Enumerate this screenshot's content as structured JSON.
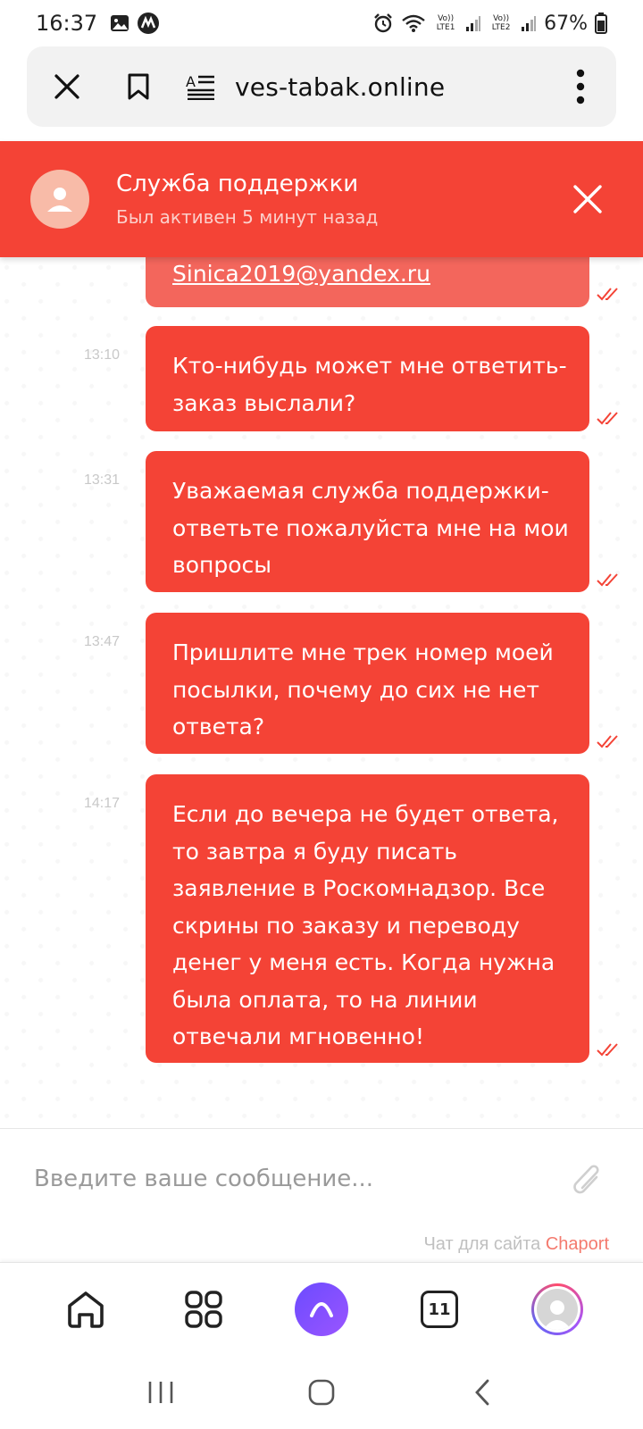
{
  "status_bar": {
    "time": "16:37",
    "battery": "67%",
    "sim1_label": "Vo)) LTE1",
    "sim2_label": "Vo)) LTE2"
  },
  "browser": {
    "url": "ves-tabak.online"
  },
  "chat": {
    "title": "Служба поддержки",
    "subtitle": "Был активен 5 минут назад",
    "messages": [
      {
        "text": "Sinica2019@yandex.ru",
        "time": ""
      },
      {
        "text": "Кто-нибудь может мне ответить- заказ выслали?",
        "time": "13:10"
      },
      {
        "text": "Уважаемая служба поддержки- ответьте пожалуйста мне на мои вопросы",
        "time": "13:31"
      },
      {
        "text": "Пришлите мне трек номер моей посылки, почему до сих не нет ответа?",
        "time": "13:47"
      },
      {
        "text": "Если до вечера не будет ответа, то завтра я буду писать заявление в Роскомнадзор. Все скрины по заказу и переводу денег у меня есть. Когда нужна была оплата, то на линии отвечали мгновенно!",
        "time": "14:17"
      }
    ],
    "input_placeholder": "Введите ваше сообщение...",
    "powered_prefix": "Чат для сайта",
    "powered_brand": "Chaport"
  },
  "bottom_nav": {
    "tabs_count": "11"
  },
  "colors": {
    "accent": "#f44336",
    "accent_faded": "#f3665c",
    "check": "#f44336"
  }
}
